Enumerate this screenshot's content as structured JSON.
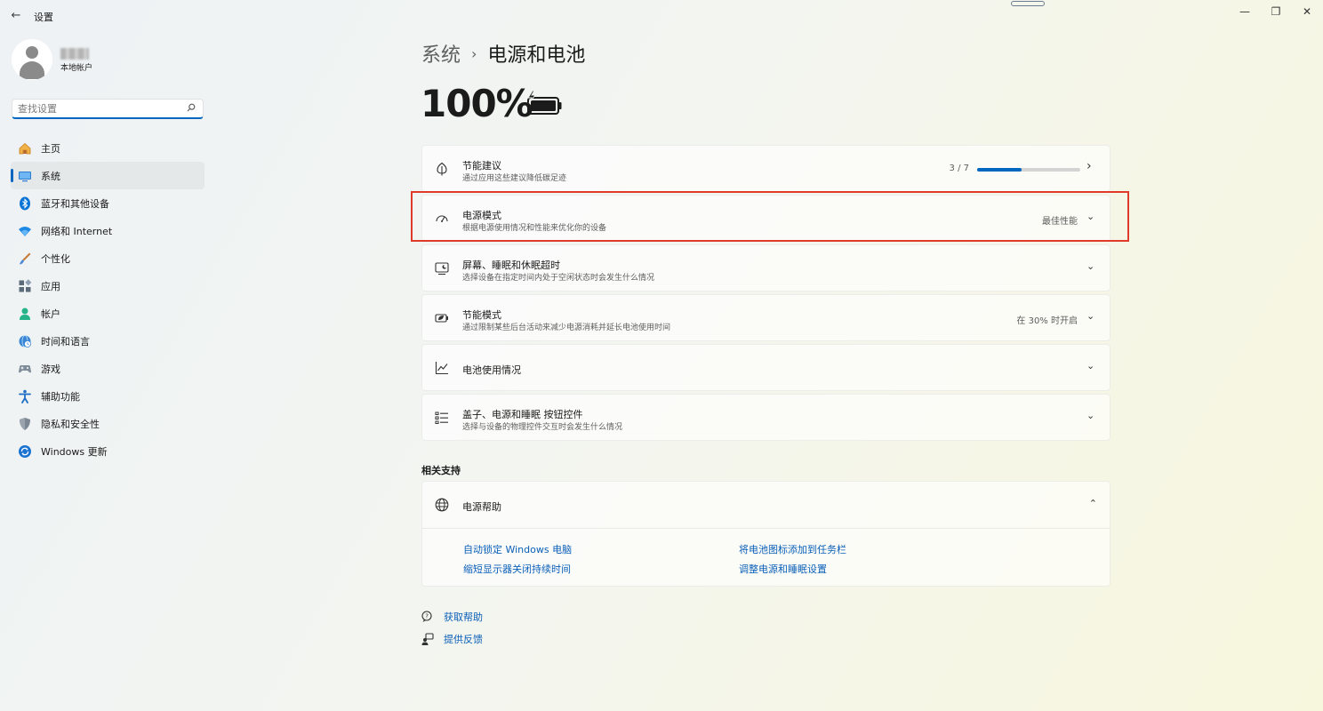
{
  "window": {
    "title": "设置",
    "back_glyph": "←",
    "minimize_glyph": "—",
    "restore_glyph": "❐",
    "close_glyph": "✕"
  },
  "sidebar": {
    "account_type": "本地帐户",
    "search_placeholder": "查找设置",
    "items": [
      {
        "label": "主页",
        "icon": "home-icon"
      },
      {
        "label": "系统",
        "icon": "system-icon",
        "active": true
      },
      {
        "label": "蓝牙和其他设备",
        "icon": "bluetooth-icon"
      },
      {
        "label": "网络和 Internet",
        "icon": "wifi-icon"
      },
      {
        "label": "个性化",
        "icon": "brush-icon"
      },
      {
        "label": "应用",
        "icon": "apps-icon"
      },
      {
        "label": "帐户",
        "icon": "account-icon"
      },
      {
        "label": "时间和语言",
        "icon": "globe-clock-icon"
      },
      {
        "label": "游戏",
        "icon": "gamepad-icon"
      },
      {
        "label": "辅助功能",
        "icon": "accessibility-icon"
      },
      {
        "label": "隐私和安全性",
        "icon": "shield-icon"
      },
      {
        "label": "Windows 更新",
        "icon": "update-icon"
      }
    ]
  },
  "header": {
    "breadcrumb_parent": "系统",
    "breadcrumb_sep": "›",
    "breadcrumb_current": "电源和电池",
    "battery_percent": "100%",
    "battery_level": 1.0
  },
  "settings": {
    "energy_recommendations": {
      "title": "节能建议",
      "subtitle": "通过应用这些建议降低碳足迹",
      "progress_text": "3 / 7",
      "progress_fraction": 0.43,
      "chevron": "›"
    },
    "power_mode": {
      "title": "电源模式",
      "subtitle": "根据电源使用情况和性能来优化你的设备",
      "value": "最佳性能",
      "chevron": "⌄"
    },
    "screen_sleep": {
      "title": "屏幕、睡眠和休眠超时",
      "subtitle": "选择设备在指定时间内处于空闲状态时会发生什么情况",
      "chevron": "⌄"
    },
    "energy_saver": {
      "title": "节能模式",
      "subtitle": "通过限制某些后台活动来减少电源消耗并延长电池使用时间",
      "value": "在 30% 时开启",
      "chevron": "⌄"
    },
    "battery_usage": {
      "title": "电池使用情况",
      "chevron": "⌄"
    },
    "lid_buttons": {
      "title": "盖子、电源和睡眠 按钮控件",
      "subtitle": "选择与设备的物理控件交互时会发生什么情况",
      "chevron": "⌄"
    }
  },
  "related": {
    "section_title": "相关支持",
    "help_title": "电源帮助",
    "help_chevron": "⌃",
    "links": [
      "自动锁定 Windows 电脑",
      "将电池图标添加到任务栏",
      "缩短显示器关闭持续时间",
      "调整电源和睡眠设置"
    ]
  },
  "footer": {
    "get_help": "获取帮助",
    "feedback": "提供反馈"
  },
  "colors": {
    "accent": "#0067c0",
    "link": "#0a5fb8",
    "highlight_box": "#e03a2b"
  }
}
